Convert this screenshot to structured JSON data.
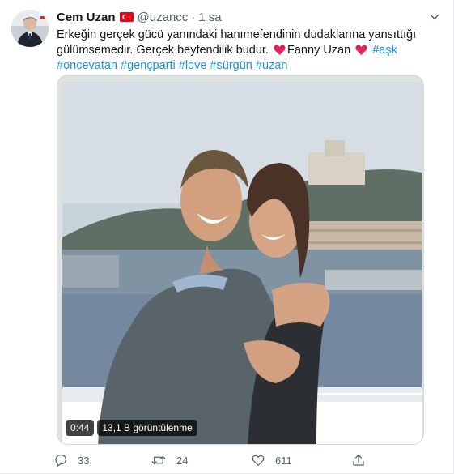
{
  "tweet": {
    "author_name": "Cem Uzan",
    "handle": "@uzancc",
    "separator": "·",
    "time": "1 sa",
    "text_line1": "Erkeğin gerçek gücü yanındaki hanımefendinin dudaklarına yansıttığı",
    "text_line2a": "gülümsemedir. Gerçek beyfendilik budur. ",
    "mention_name": "Fanny Uzan",
    "hashtags_line2": "#aşk",
    "hashtags_line3": [
      "#oncevatan",
      "#gençparti",
      "#love",
      "#sürgün",
      "#uzan"
    ]
  },
  "media": {
    "duration": "0:44",
    "views": "13,1 B görüntülenme"
  },
  "actions": {
    "reply_count": "33",
    "retweet_count": "24",
    "like_count": "611"
  },
  "icons": {
    "flag": "turkey-flag-icon",
    "heart_emoji": "red-heart-icon",
    "more": "more-options-icon",
    "reply": "reply-icon",
    "retweet": "retweet-icon",
    "like": "like-icon",
    "share": "share-icon"
  },
  "colors": {
    "link": "#1b95e0",
    "muted": "#536471",
    "heart": "#e0245e",
    "flag_red": "#e30a17"
  }
}
